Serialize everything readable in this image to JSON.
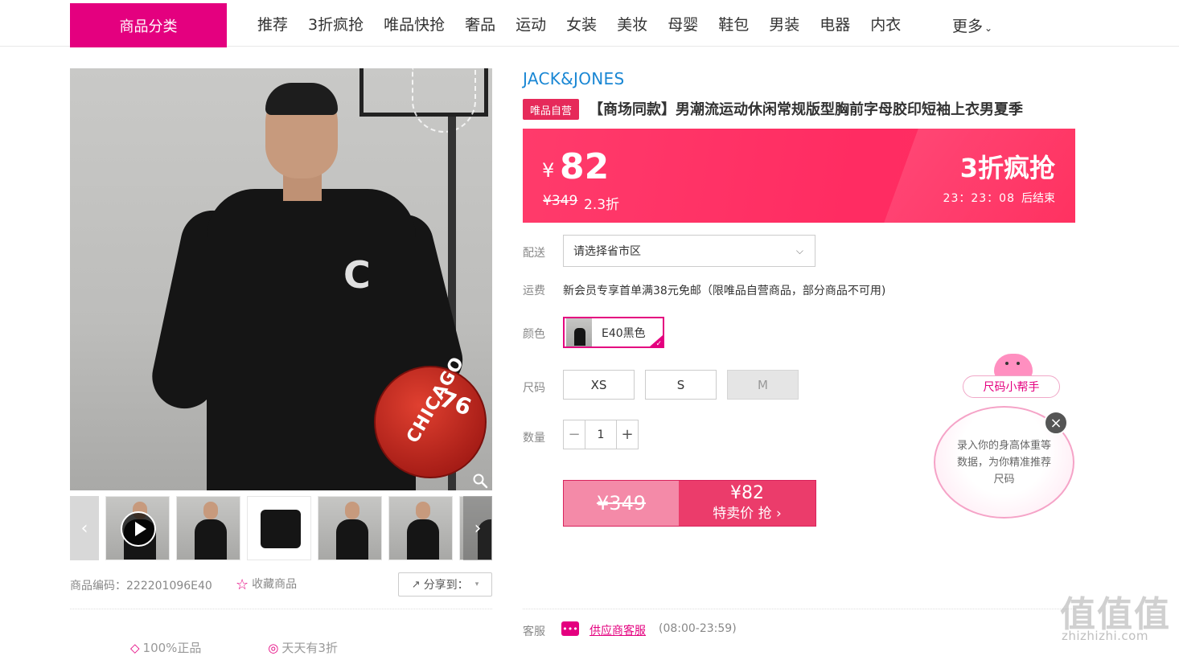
{
  "nav": {
    "category_button": "商品分类",
    "items": [
      "推荐",
      "3折疯抢",
      "唯品快抢",
      "奢品",
      "运动",
      "女装",
      "美妆",
      "母婴",
      "鞋包",
      "男装",
      "电器",
      "内衣"
    ],
    "more": "更多"
  },
  "product": {
    "brand": "JACK&JONES",
    "tag": "唯品自营",
    "title": "【商场同款】男潮流运动休闲常规版型胸前字母胶印短袖上衣男夏季",
    "sku_label": "商品编码：222201096E40",
    "favorite": "收藏商品",
    "share": "分享到：",
    "main_image": {
      "shirt_letter": "C",
      "ball_text": "CHICAGO",
      "ball_number": "76"
    }
  },
  "price": {
    "currency": "¥",
    "now": "82",
    "original": "¥349",
    "discount": "2.3折",
    "promo": "3折疯抢",
    "countdown": "23：23：08",
    "countdown_suffix": "后结束"
  },
  "options": {
    "delivery_label": "配送",
    "delivery_placeholder": "请选择省市区",
    "freight_label": "运费",
    "freight_text": "新会员专享首单满38元免邮（限唯品自营商品，部分商品不可用)",
    "color_label": "颜色",
    "color_value": "E40黑色",
    "size_label": "尺码",
    "sizes": [
      "XS",
      "S",
      "M"
    ],
    "quantity_label": "数量",
    "quantity": "1"
  },
  "buy": {
    "original": "¥349",
    "price": "¥82",
    "label": "特卖价 抢 ›"
  },
  "size_helper": {
    "title": "尺码小帮手",
    "text": "录入你的身高体重等数据，为你精准推荐尺码"
  },
  "service": {
    "label": "客服",
    "link": "供应商客服",
    "hours": "(08:00-23:59)"
  },
  "guarantees": [
    "100%正品",
    "天天有3折"
  ],
  "watermark": {
    "glyphs": "值值值",
    "domain": "zhizhizhi.com"
  },
  "colors": {
    "brand_pink": "#e4007f",
    "price_banner": "#ff2c62",
    "brand_blue": "#1a87d4"
  }
}
